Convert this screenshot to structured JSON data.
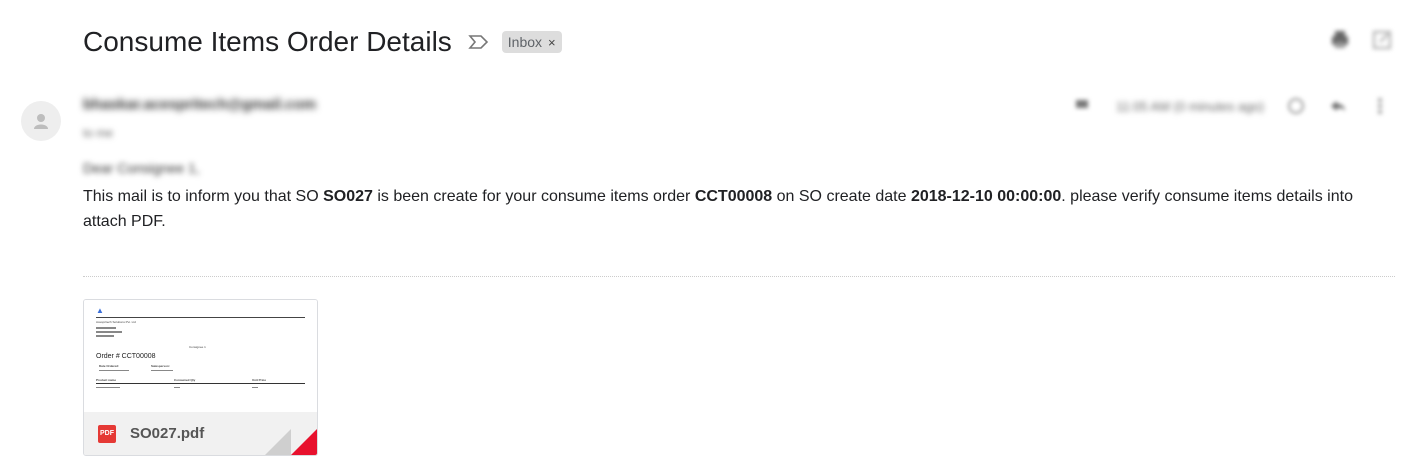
{
  "email": {
    "subject": "Consume Items Order Details",
    "label": "Inbox",
    "label_remove": "×",
    "sender": "bhaskar.acespritech@gmail.com",
    "to": "to me",
    "time": "11:05 AM (0 minutes ago)",
    "greeting": "Dear Consignee 1,",
    "body": {
      "p1": "This mail is to inform you that SO ",
      "so": "SO027",
      "p2": " is been create for your consume items order ",
      "order": "CCT00008",
      "p3": " on SO create date ",
      "date": "2018-12-10 00:00:00",
      "p4": ". please verify consume items details into attach PDF."
    }
  },
  "attachment": {
    "file_name": "SO027.pdf",
    "type_badge": "PDF",
    "preview": {
      "order_title": "Order # CCT00008",
      "company": "Acespritech Solutions Pvt. Ltd",
      "consignee": "Consignee 1",
      "col_date": "Date Ordered:",
      "col_salesperson": "Salesperson:",
      "col_product": "Product name",
      "col_qty": "Consumed Qty",
      "col_unit": "Unit Price"
    }
  },
  "icons": {
    "importance": "importance-arrow-icon",
    "print": "print-icon",
    "open_new": "open-in-new-window-icon",
    "star": "star-icon",
    "reply": "reply-icon",
    "more": "more-vert-icon",
    "avatar": "person-icon"
  }
}
